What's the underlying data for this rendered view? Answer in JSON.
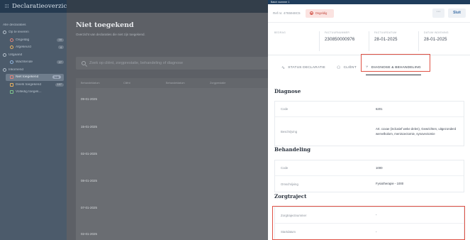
{
  "app": {
    "title": "Declaratieoverzicht"
  },
  "sidebar": {
    "items": [
      {
        "label": "Alle declaraties",
        "badge": ""
      },
      {
        "label": "Op te leveren",
        "badge": ""
      },
      {
        "label": "Ongeldig",
        "badge": "16"
      },
      {
        "label": "Afgekeurd",
        "badge": "4"
      },
      {
        "label": "Uitgaand",
        "badge": ""
      },
      {
        "label": "Wachtende",
        "badge": "27"
      },
      {
        "label": "Inkomend",
        "badge": ""
      },
      {
        "label": "Niet toegekend",
        "badge": "546"
      },
      {
        "label": "Deels toegekend",
        "badge": "107"
      },
      {
        "label": "Volledig toegek...",
        "badge": ""
      }
    ]
  },
  "main": {
    "title": "Niet toegekend",
    "subtitle": "Overzicht van declaraties die niet zijn toegekend.",
    "search_placeholder": "Zoek op cliënt, zorgprestatie, behandeling of diagnose",
    "columns": [
      "Behandeldatum",
      "Cliënt",
      "Behandeldatum",
      "Zorgprestatie"
    ],
    "rows": [
      "09-01-2025",
      "15-01-2025",
      "02-01-2025",
      "08-01-2025",
      "07-01-2025",
      "02-01-2025"
    ]
  },
  "panel": {
    "topbar": "Batch nummer 1",
    "ref": "Ref nr. 4765948C5",
    "status": "Ongeldig",
    "more_label": "⋯",
    "close_label": "Sluit",
    "summary": [
      {
        "label": "BEDRAG",
        "value": ""
      },
      {
        "label": "FACTUURNUMMER",
        "value": "230850000976"
      },
      {
        "label": "FACTUURDATUM",
        "value": "28-01-2025"
      },
      {
        "label": "DATUM INDIENING",
        "value": "28-01-2025"
      }
    ],
    "tabs": [
      {
        "label": "STATUS DECLARATIE",
        "icon": "∿"
      },
      {
        "label": "CLIËNT",
        "icon": "⚇"
      },
      {
        "label": "DIAGNOSE & BEHANDELING",
        "icon": "⑂"
      }
    ],
    "diagnose": {
      "title": "Diagnose",
      "code_label": "Code",
      "code_value": "6201",
      "desc_label": "Beschrijving",
      "desc_value": "Art. coxae (inclusief weke delen), Gewrichten, uitgezonderd wervelkolom, meniscectomie, synovectomie"
    },
    "behandeling": {
      "title": "Behandeling",
      "code_label": "Code",
      "code_value": "1000",
      "desc_label": "Omschrijving",
      "desc_value": "Fysiotherapie - 1000"
    },
    "zorgtraject": {
      "title": "Zorgtraject",
      "number_label": "Zorgtrajectnummer",
      "number_value": "-",
      "start_label": "Startdatum",
      "start_value": "-"
    }
  },
  "colors": {
    "highlight": "#e05245",
    "status_bg": "#fbe3e1",
    "sidebar_bg": "#4c5b6b",
    "header_bg": "#253a50"
  }
}
